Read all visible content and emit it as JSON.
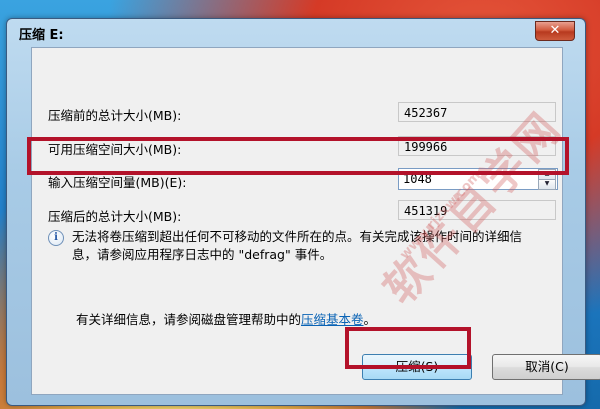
{
  "window": {
    "title": "压缩 E:",
    "close_glyph": "✕"
  },
  "fields": {
    "total_before_label": "压缩前的总计大小(MB):",
    "total_before_value": "452367",
    "available_label": "可用压缩空间大小(MB):",
    "available_value": "199966",
    "shrink_amount_label": "输入压缩空间量(MB)(E):",
    "shrink_amount_value": "1048",
    "total_after_label": "压缩后的总计大小(MB):",
    "total_after_value": "451319"
  },
  "info": {
    "icon": "info-icon",
    "icon_glyph": "i",
    "text": "无法将卷压缩到超出任何不可移动的文件所在的点。有关完成该操作时间的详细信息，请参阅应用程序日志中的 \"defrag\" 事件。"
  },
  "help": {
    "prefix": "有关详细信息，请参阅磁盘管理帮助中的",
    "link": "压缩基本卷",
    "suffix": "。"
  },
  "buttons": {
    "shrink": "压缩(S)",
    "cancel": "取消(C)"
  },
  "spinner": {
    "up_glyph": "▲",
    "down_glyph": "▼"
  },
  "watermark": {
    "text": "软件自学网",
    "url": "www.rjzxw.com"
  },
  "colors": {
    "highlight": "#b3122a",
    "link": "#0a63b5"
  }
}
